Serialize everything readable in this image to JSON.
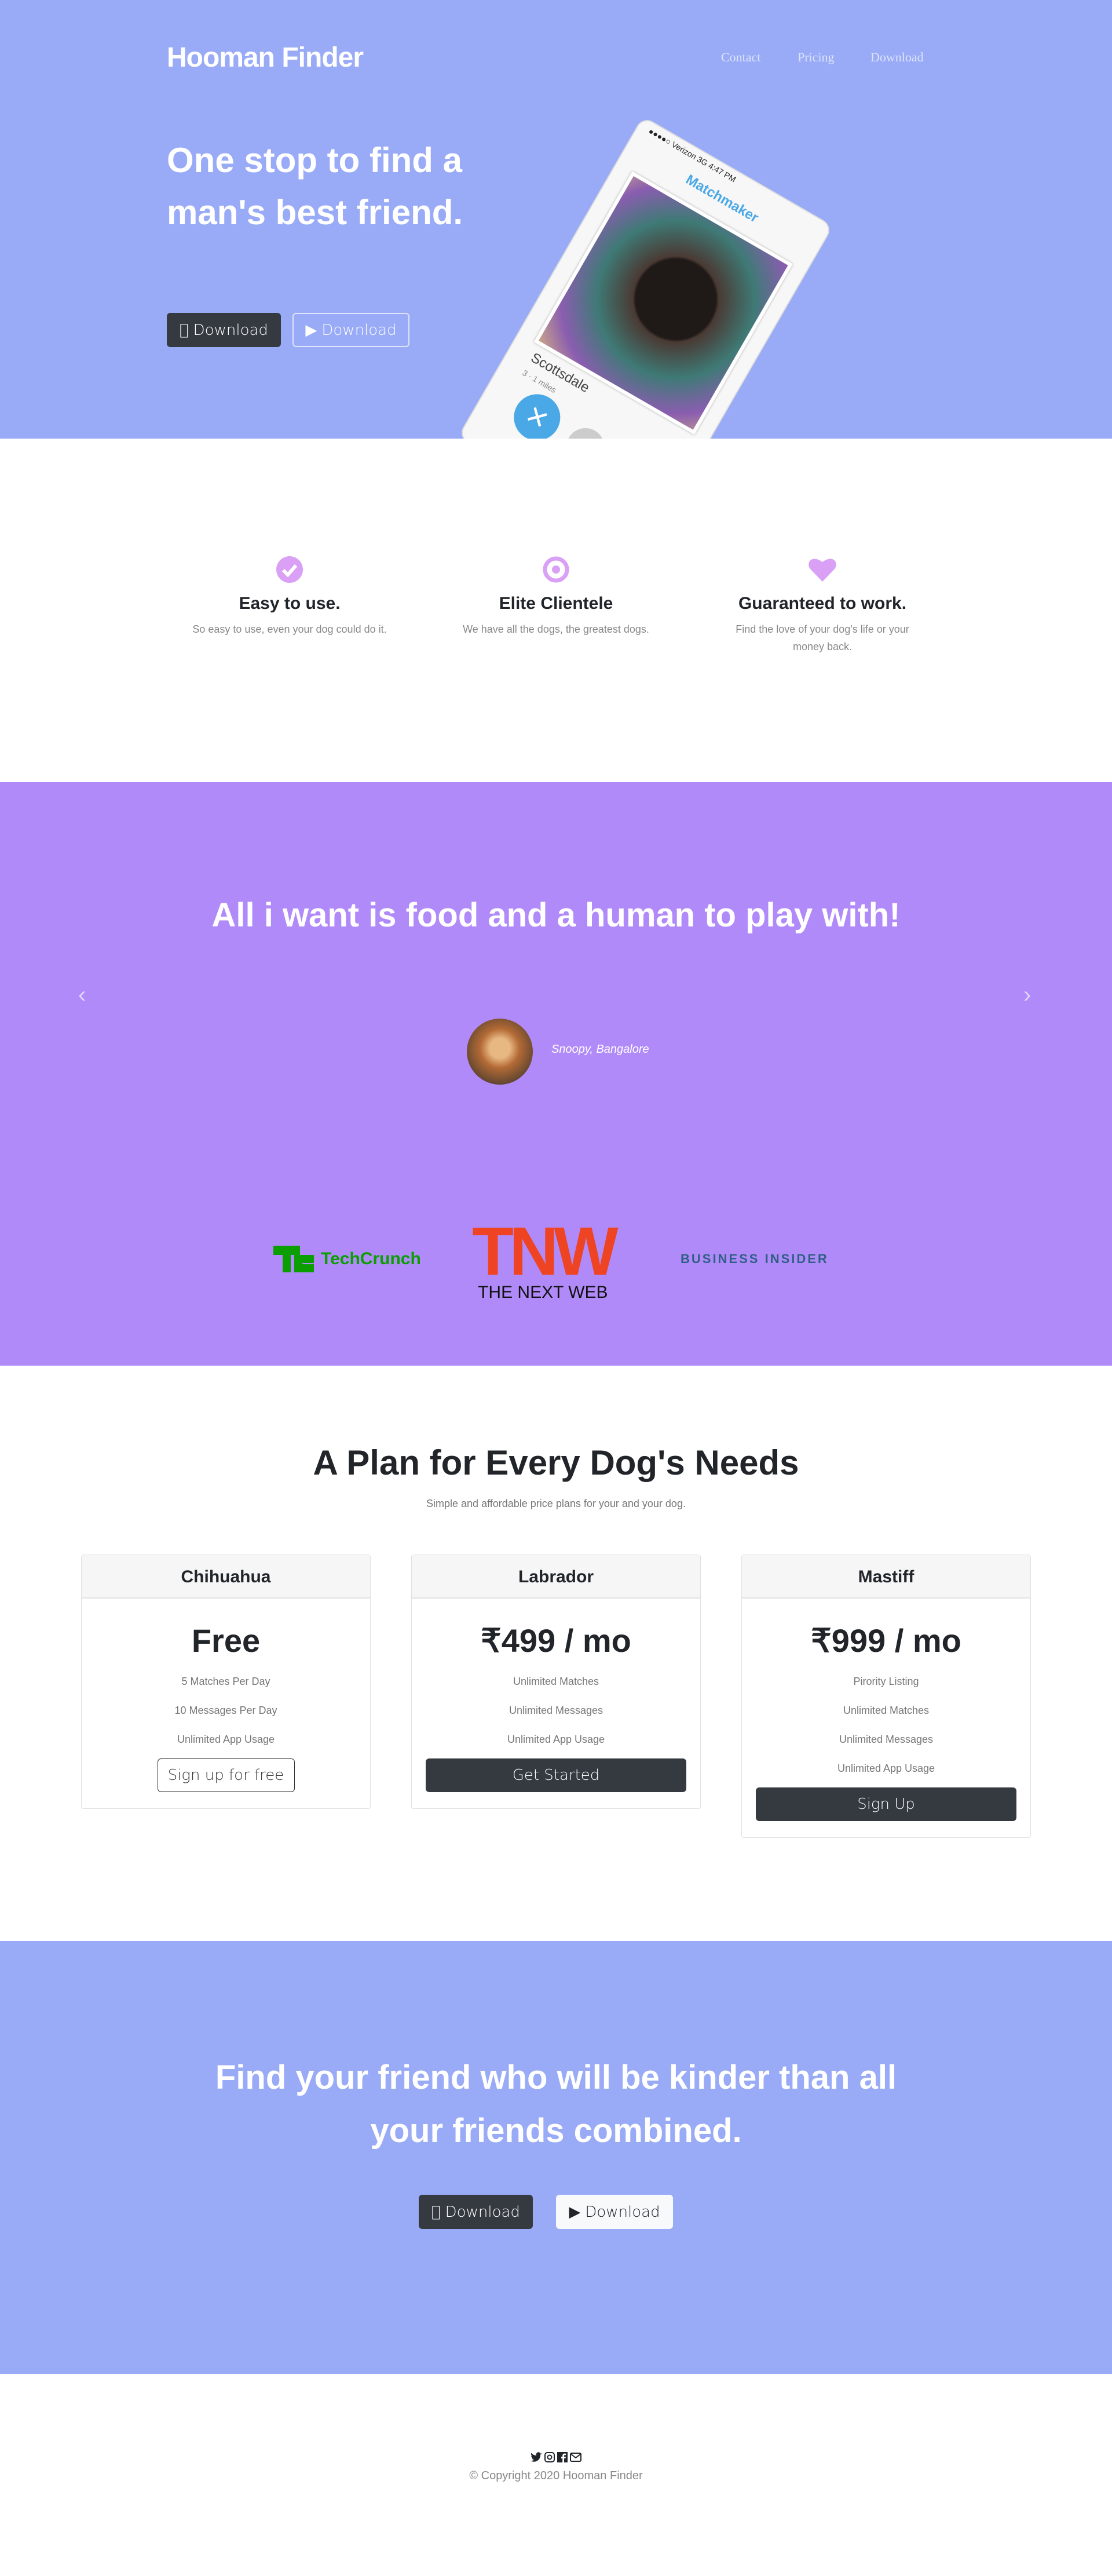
{
  "colors": {
    "hero_bg": "#99abf6",
    "testimonial_bg": "#b18af9",
    "icon_accent": "#d9a0f5",
    "dark_button": "#343a40"
  },
  "header": {
    "brand": "Hooman Finder",
    "nav": [
      "Contact",
      "Pricing",
      "Download"
    ]
  },
  "hero": {
    "headline": "One stop to find a man's best friend.",
    "apple_button": "Download",
    "play_button": "Download",
    "phone": {
      "status": "●●●●○ Verizon  3G   4:47 PM",
      "app_title": "Matchmaker",
      "caption": "Scottsdale",
      "meta": "3 · 1 miles"
    }
  },
  "features": [
    {
      "icon": "check-circle-icon",
      "title": "Easy to use.",
      "text": "So easy to use, even your dog could do it."
    },
    {
      "icon": "bullseye-icon",
      "title": "Elite Clientele",
      "text": "We have all the dogs, the greatest dogs."
    },
    {
      "icon": "heart-icon",
      "title": "Guaranteed to work.",
      "text": "Find the love of your dog's life or your money back."
    }
  ],
  "testimonial": {
    "quote": "All i want is food and a human to play with!",
    "author": "Snoopy, Bangalore",
    "prev": "‹",
    "next": "›"
  },
  "press": {
    "techcrunch": "TechCrunch",
    "tnw_mark": "TNW",
    "tnw_name": "THE NEXT WEB",
    "business_insider": "BUSINESS INSIDER"
  },
  "pricing": {
    "title": "A Plan for Every Dog's Needs",
    "subtitle": "Simple and affordable price plans for your and your dog.",
    "plans": [
      {
        "name": "Chihuahua",
        "price": "Free",
        "features": [
          "5 Matches Per Day",
          "10 Messages Per Day",
          "Unlimited App Usage"
        ],
        "cta": "Sign up for free"
      },
      {
        "name": "Labrador",
        "price": "₹499 / mo",
        "features": [
          "Unlimited Matches",
          "Unlimited Messages",
          "Unlimited App Usage"
        ],
        "cta": "Get Started"
      },
      {
        "name": "Mastiff",
        "price": "₹999 / mo",
        "features": [
          "Pirority Listing",
          "Unlimited Matches",
          "Unlimited Messages",
          "Unlimited App Usage"
        ],
        "cta": "Sign Up"
      }
    ]
  },
  "cta": {
    "text": "Find your friend who will be kinder than all your friends combined.",
    "apple_button": "Download",
    "play_button": "Download"
  },
  "footer": {
    "social": [
      "twitter-icon",
      "instagram-icon",
      "facebook-icon",
      "envelope-icon"
    ],
    "copyright": "© Copyright 2020 Hooman Finder"
  }
}
